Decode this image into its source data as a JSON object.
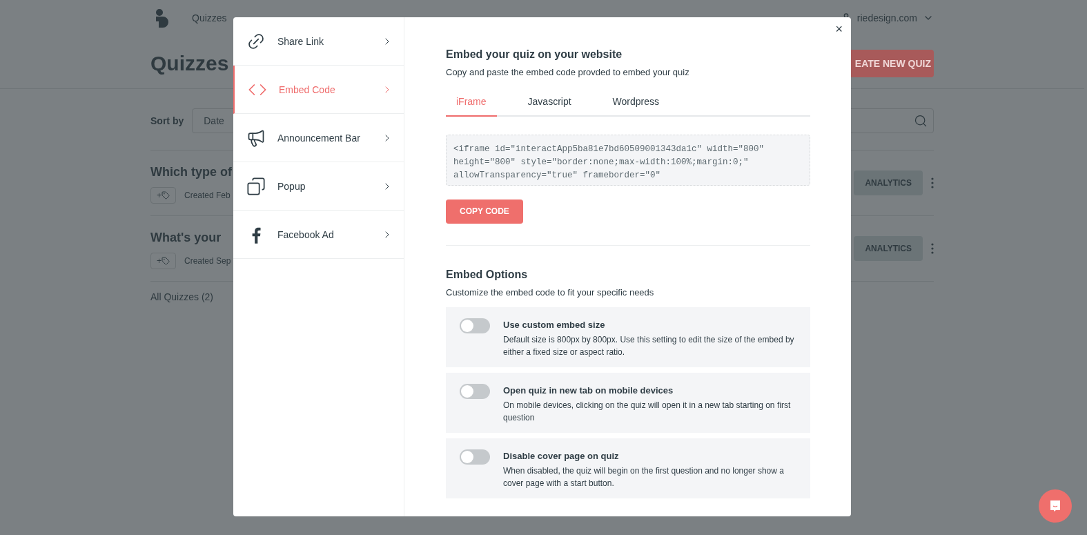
{
  "nav": {
    "links": [
      {
        "label": "Quizzes"
      }
    ],
    "account": "riedesign.com"
  },
  "page": {
    "title": "Quizzes",
    "create_button": "EATE NEW QUIZ",
    "sort_label": "Sort by",
    "sort_value": "Date",
    "quizzes": [
      {
        "title": "Which type of",
        "add_tag": "+",
        "created": "Created Feb",
        "analytics": "ANALYTICS"
      },
      {
        "title": "What's your",
        "add_tag": "+",
        "created": "Created Sep",
        "analytics": "ANALYTICS"
      }
    ],
    "footer": "All Quizzes (2)"
  },
  "modal": {
    "menu": [
      {
        "kind": "link",
        "label": "Share Link",
        "selected": false
      },
      {
        "kind": "code",
        "label": "Embed Code",
        "selected": true
      },
      {
        "kind": "megaphone",
        "label": "Announcement Bar",
        "selected": false
      },
      {
        "kind": "popup",
        "label": "Popup",
        "selected": false
      },
      {
        "kind": "facebook",
        "label": "Facebook Ad",
        "selected": false
      }
    ],
    "close": "×",
    "heading": "Embed your quiz on your website",
    "subheading": "Copy and paste the embed code provded to embed your quiz",
    "tabs": [
      {
        "label": "iFrame",
        "selected": true
      },
      {
        "label": "Javascript",
        "selected": false
      },
      {
        "label": "Wordpress",
        "selected": false
      }
    ],
    "code": "<iframe id=\"interactApp5ba81e7bd60509001343da1c\" width=\"800\" height=\"800\" style=\"border:none;max-width:100%;margin:0;\" allowTransparency=\"true\" frameborder=\"0\"",
    "copy_button": "COPY CODE",
    "options_heading": "Embed Options",
    "options_subheading": "Customize the embed code to fit your specific needs",
    "options": [
      {
        "title": "Use custom embed size",
        "description": "Default size is 800px by 800px. Use this setting to edit the size of the embed by either a fixed size or aspect ratio.",
        "on": false
      },
      {
        "title": "Open quiz in new tab on mobile devices",
        "description": "On mobile devices, clicking on the quiz will open it in a new tab starting on first question",
        "on": false
      },
      {
        "title": "Disable cover page on quiz",
        "description": "When disabled, the quiz will begin on the first question and no longer show a cover page with a start button.",
        "on": false
      }
    ]
  }
}
